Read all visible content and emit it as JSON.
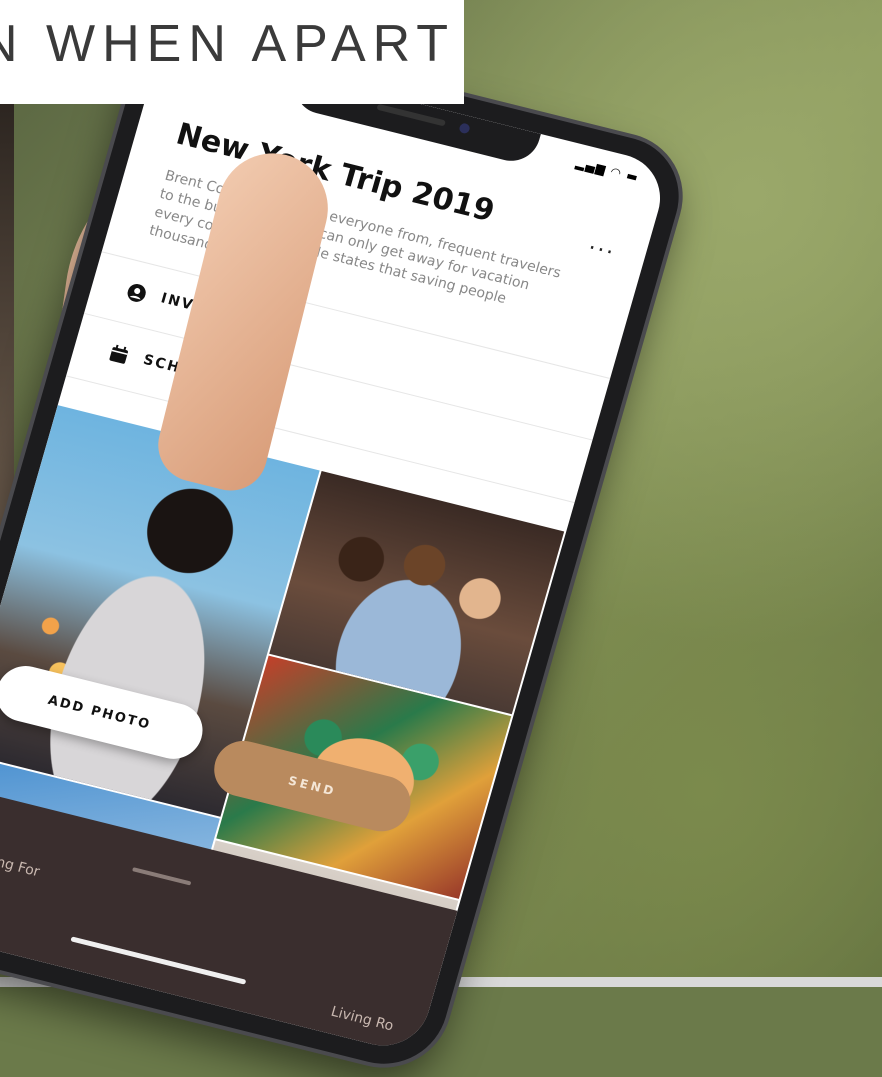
{
  "header": {
    "text": "N WHEN APART"
  },
  "app": {
    "title": "New York Trip 2019",
    "more_label": "...",
    "description": "Brent Conrad talks with everyone from, frequent travelers to the busy family that can only get away for vacation every couple of years. He states that saving people thousands.",
    "menu": [
      {
        "label": "INVITE PEOPLE",
        "icon": "person-circle-icon"
      },
      {
        "label": "SCHEDULE",
        "icon": "calendar-icon"
      }
    ],
    "buttons": {
      "add_photo": "ADD PHOTO",
      "send": "SEND"
    },
    "bottom": {
      "selecting_for": "Selecting For",
      "living_room": "Living Ro"
    }
  },
  "colors": {
    "send_button": "#b98a5e",
    "bottom_bar": "#3a2e2e"
  }
}
